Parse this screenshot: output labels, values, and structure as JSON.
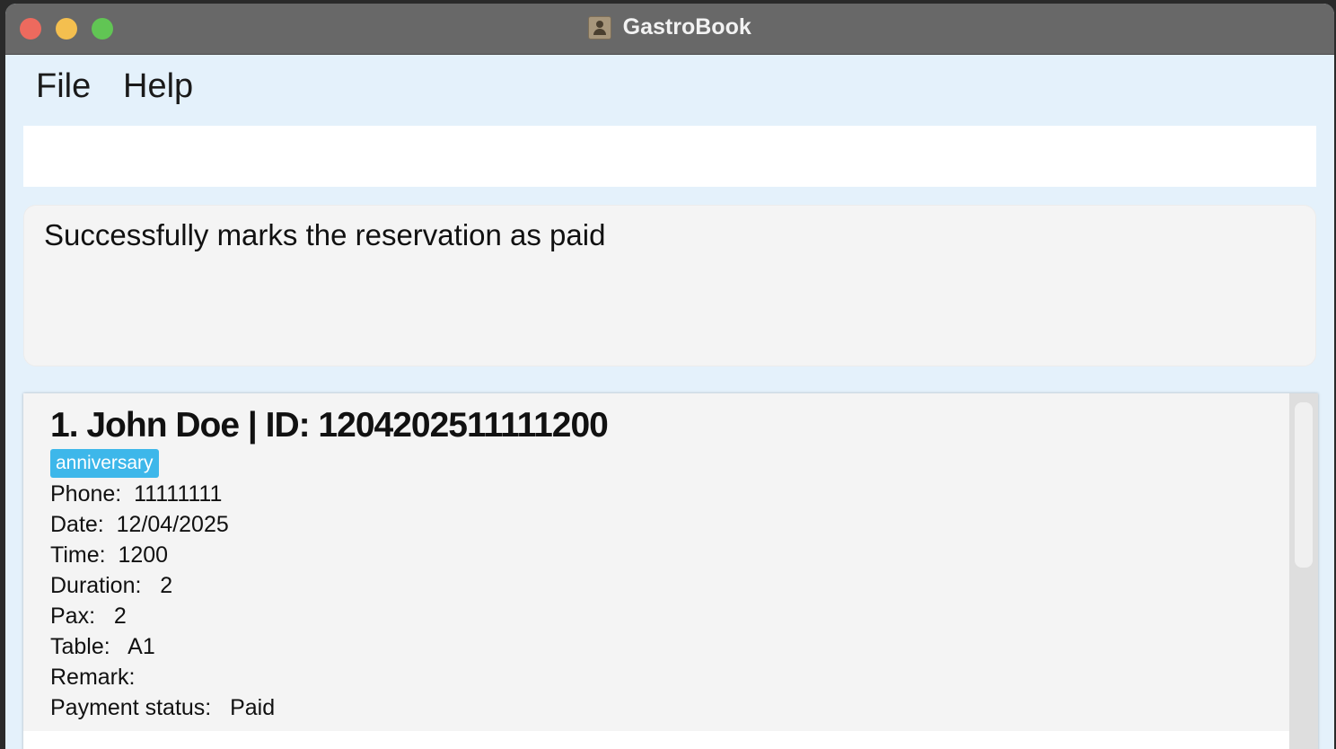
{
  "window": {
    "title": "GastroBook"
  },
  "menu": {
    "file": "File",
    "help": "Help"
  },
  "command": {
    "value": "",
    "placeholder": ""
  },
  "result": {
    "message": "Successfully marks the reservation as paid"
  },
  "reservations": [
    {
      "title": "1. John Doe | ID: 1204202511111200",
      "tags": [
        "anniversary"
      ],
      "phone": "Phone:  11111111",
      "date": "Date:  12/04/2025",
      "time": "Time:  1200",
      "duration": "Duration:   2",
      "pax": "Pax:   2",
      "table": "Table:   A1",
      "remark": "Remark:",
      "payment": "Payment status:   Paid"
    }
  ],
  "colors": {
    "tag": "#3db7ea",
    "background": "#e4f1fb",
    "titlebar": "#686868"
  },
  "icons": {
    "app": "contacts-book-icon"
  }
}
